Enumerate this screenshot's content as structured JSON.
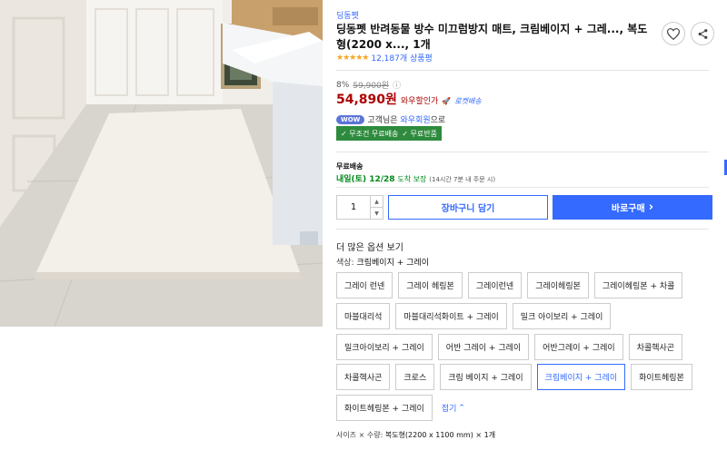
{
  "product": {
    "brand": "딩동펫",
    "title": "딩동펫 반려동물 방수 미끄럼방지 매트, 크림베이지 + 그레..., 복도형(2200 x..., 1개",
    "stars": "★★★★★",
    "review_count": "12,187개 상품평"
  },
  "price": {
    "discount_rate": "8%",
    "original_price": "59,900원",
    "info_icon": "ⓘ",
    "sale_price": "54,890원",
    "wow_price_label": "와우할인가",
    "rocket_label": "로켓배송"
  },
  "wow": {
    "badge": "WOW",
    "text_prefix": "고객님은",
    "link": "와우회원",
    "text_suffix": "으로",
    "benefit_1": "✓ 무조건 무료배송",
    "benefit_2": "✓ 무료반품"
  },
  "shipping": {
    "label": "무료배송",
    "date": "내일(토) 12/28",
    "guarantee": "도착 보장",
    "note": "(14시간 7분 내 주문 시)"
  },
  "purchase": {
    "quantity": "1",
    "cart_label": "장바구니 담기",
    "buy_label": "바로구매",
    "buy_arrow": "›"
  },
  "options": {
    "more_title": "더 많은 옵션 보기",
    "color_label": "색상:",
    "color_value": "크림베이지 + 그레이",
    "row1": [
      "그레이 런넨",
      "그레이 헤링본",
      "그레이런넨",
      "그레이헤링본",
      "그레이헤링본 + 차콜"
    ],
    "row2": [
      "마블대리석",
      "마블대리석화이트 + 그레이",
      "밀크 아이보리 + 그레이"
    ],
    "row3": [
      "밀크아이보리 + 그레이",
      "어반 그레이 + 그레이",
      "어반그레이 + 그레이",
      "차콜헥사곤"
    ],
    "row4": [
      "차콜헥사곤",
      "크로스",
      "크림 베이지 + 그레이",
      "크림베이지 + 그레이",
      "화이트헤링본"
    ],
    "row5": [
      "화이트헤링본 + 그레이"
    ],
    "fold_label": "접기",
    "selected": "크림베이지 + 그레이",
    "size_label": "사이즈 × 수량:",
    "size_value": "복도형(2200 x 1100 mm) × 1개"
  },
  "colors": {
    "accent": "#346aff",
    "price": "#ae0000",
    "benefit": "#2e8b3d",
    "delivery": "#00891a"
  },
  "icons": [
    "heart-icon",
    "share-icon",
    "info-icon",
    "rocket-icon",
    "chevron-up-icon",
    "chevron-right-icon"
  ]
}
